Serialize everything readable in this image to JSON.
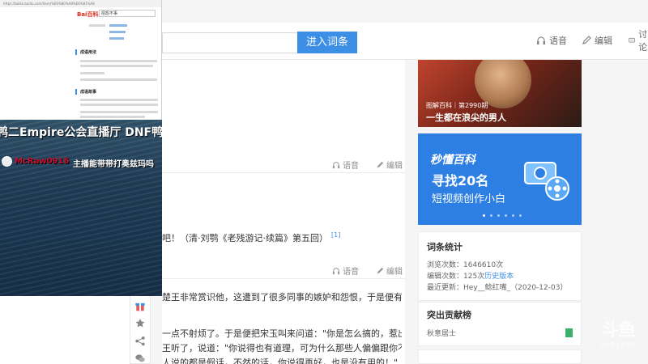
{
  "topbar": {
    "search_button": "进入词条",
    "voice_label": "语音",
    "edit_label": "编辑",
    "discuss_label": "讨论"
  },
  "article": {
    "section_voice": "语音",
    "section_edit": "编辑",
    "quote_line": "吧！（清·刘鹗《老残游记·续篇》第五回）",
    "quote_ref": "[1]",
    "para_line1": "楚王非常赏识他，这遭到了很多同事的嫉妒和怨恨，于是便有",
    "para_line2": "一点不射烦了。于是便把宋玉叫来问道：\"你是怎么搞的，惹出了",
    "para_line3": "王听了，说道：\"你说得也有道理，可为什么那些人偏偏跟你不",
    "para_line4": "人说的都是假话，不然的话，你说得再好，也是没有用的！\""
  },
  "right": {
    "banner1_tag": "图解百科｜第2990期",
    "banner1_title": "一生都在浪尖的男人",
    "banner2_brand": "秒懂百科",
    "banner2_big": "寻找20名",
    "banner2_small": "短视频创作小白",
    "stats_title": "词条统计",
    "stats_views_label": "浏览次数：",
    "stats_views": "1646610次",
    "stats_edits_label": "编辑次数：",
    "stats_edits": "125次",
    "stats_history": "历史版本",
    "stats_updated_label": "最近更新：",
    "stats_updated": "Hey__鲶红嘴_（2020-12-03）",
    "contrib_title": "突出贡献榜",
    "contrib_user": "秋意居士"
  },
  "watermark": {
    "logo": "斗鱼",
    "room": "8681350"
  },
  "thumbnail": {
    "address": "https://baike.baidu.com/item/%E6%80%A8%E6%81%A8",
    "logo": "Bai百科",
    "search_text": "招怨不事",
    "heading1": "成语用法",
    "heading2": "成语故事"
  },
  "stream": {
    "title": "鸭二Empire公会直播厅  DNF鸭",
    "chat_user": "McRaw0916",
    "chat_msg": "主播能带带打奥兹玛吗"
  },
  "colors": {
    "accent": "#3d8fe6",
    "chat_user": "#c8102e"
  }
}
